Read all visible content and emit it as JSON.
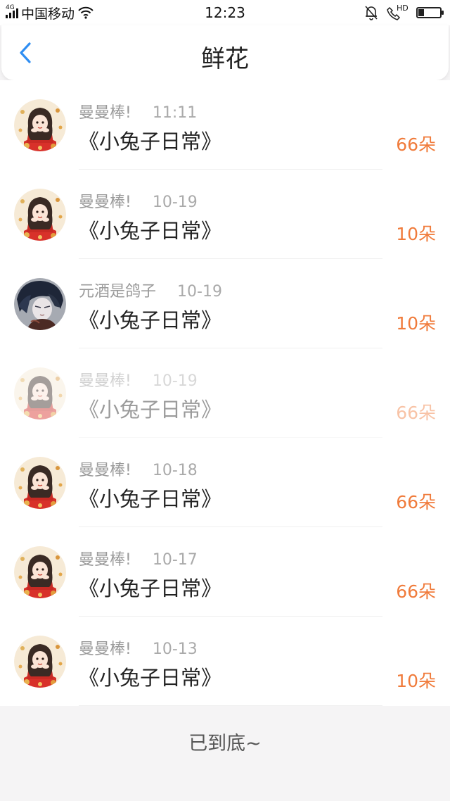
{
  "status_bar": {
    "network": "4G",
    "carrier": "中国移动",
    "time": "12:23",
    "hd_label": "HD",
    "battery_level": 0.25
  },
  "header": {
    "title": "鲜花"
  },
  "icons": {
    "back": "chevron-left-icon",
    "wifi": "wifi-icon",
    "bell": "bell-muted-icon",
    "call": "hd-call-icon",
    "battery": "battery-icon"
  },
  "colors": {
    "accent": "#2f8ef2",
    "amount": "#f07b3b"
  },
  "items": [
    {
      "user": "曼曼棒!",
      "date": "11:11",
      "title": "《小兔子日常》",
      "amount": "66朵",
      "avatar": "girl"
    },
    {
      "user": "曼曼棒!",
      "date": "10-19",
      "title": "《小兔子日常》",
      "amount": "10朵",
      "avatar": "girl"
    },
    {
      "user": "元酒是鸽子",
      "date": "10-19",
      "title": "《小兔子日常》",
      "amount": "10朵",
      "avatar": "boy"
    },
    {
      "user": "曼曼棒!",
      "date": "10-19",
      "title": "《小兔子日常》",
      "amount": "66朵",
      "avatar": "girl"
    },
    {
      "user": "曼曼棒!",
      "date": "10-18",
      "title": "《小兔子日常》",
      "amount": "66朵",
      "avatar": "girl"
    },
    {
      "user": "曼曼棒!",
      "date": "10-17",
      "title": "《小兔子日常》",
      "amount": "66朵",
      "avatar": "girl"
    },
    {
      "user": "曼曼棒!",
      "date": "10-13",
      "title": "《小兔子日常》",
      "amount": "10朵",
      "avatar": "girl"
    }
  ],
  "footer": {
    "text": "已到底~"
  }
}
